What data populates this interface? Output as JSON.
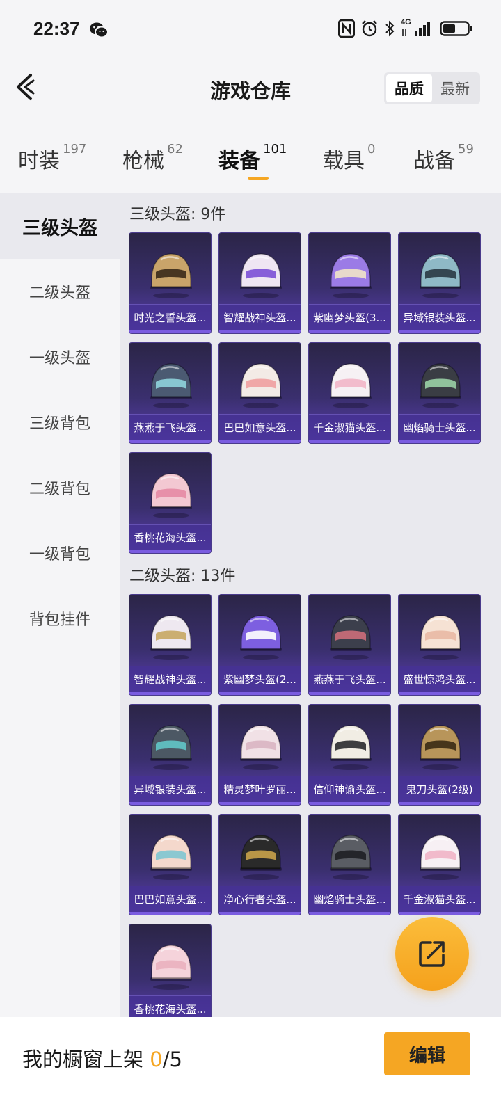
{
  "status_bar": {
    "time": "22:37",
    "network_label": "4G"
  },
  "header": {
    "title": "游戏仓库",
    "sort_options": [
      "品质",
      "最新"
    ],
    "sort_selected": "品质"
  },
  "tabs": [
    {
      "label": "时装",
      "count": "197"
    },
    {
      "label": "枪械",
      "count": "62"
    },
    {
      "label": "装备",
      "count": "101",
      "active": true
    },
    {
      "label": "载具",
      "count": "0"
    },
    {
      "label": "战备",
      "count": "59"
    }
  ],
  "sidebar": {
    "items": [
      {
        "label": "三级头盔",
        "active": true
      },
      {
        "label": "二级头盔"
      },
      {
        "label": "一级头盔"
      },
      {
        "label": "三级背包"
      },
      {
        "label": "二级背包"
      },
      {
        "label": "一级背包"
      },
      {
        "label": "背包挂件"
      }
    ]
  },
  "sections": [
    {
      "title": "三级头盔: 9件",
      "items": [
        {
          "name": "时光之誓头盔...",
          "color": "#c9a46a",
          "visor": "#3a2a1a"
        },
        {
          "name": "智耀战神头盔...",
          "color": "#efe6f3",
          "visor": "#7b4fd6"
        },
        {
          "name": "紫幽梦头盔(3...",
          "color": "#9b7be6",
          "visor": "#f1e4c8"
        },
        {
          "name": "异域银装头盔...",
          "color": "#8fb9c6",
          "visor": "#2a3a44"
        },
        {
          "name": "燕燕于飞头盔...",
          "color": "#4b5a72",
          "visor": "#8fd3dc"
        },
        {
          "name": "巴巴如意头盔...",
          "color": "#f3ebe6",
          "visor": "#f0a0a0"
        },
        {
          "name": "千金淑猫头盔...",
          "color": "#f6f1f4",
          "visor": "#f2b6c8"
        },
        {
          "name": "幽焰骑士头盔...",
          "color": "#3a3d44",
          "visor": "#9ad0a6"
        },
        {
          "name": "香桃花海头盔...",
          "color": "#f3c8d2",
          "visor": "#e58aa4"
        }
      ]
    },
    {
      "title": "二级头盔: 13件",
      "items": [
        {
          "name": "智耀战神头盔...",
          "color": "#eee8f0",
          "visor": "#c7a763"
        },
        {
          "name": "紫幽梦头盔(2...",
          "color": "#7d5fe0",
          "visor": "#ffffff"
        },
        {
          "name": "燕燕于飞头盔...",
          "color": "#3c3f4c",
          "visor": "#cc6e7a"
        },
        {
          "name": "盛世惊鸿头盔...",
          "color": "#f6e2d4",
          "visor": "#e9b9a4"
        },
        {
          "name": "异域银装头盔...",
          "color": "#4c5864",
          "visor": "#62c7c7"
        },
        {
          "name": "精灵梦叶罗丽...",
          "color": "#f1e1e6",
          "visor": "#d9b5c2"
        },
        {
          "name": "信仰神谕头盔...",
          "color": "#f1ede4",
          "visor": "#2a2a2e"
        },
        {
          "name": "鬼刀头盔(2级)",
          "color": "#b8955a",
          "visor": "#3a2a14"
        },
        {
          "name": "巴巴如意头盔...",
          "color": "#f4d8cc",
          "visor": "#7fc6d2"
        },
        {
          "name": "净心行者头盔...",
          "color": "#2a2a2a",
          "visor": "#c9a24a"
        },
        {
          "name": "幽焰骑士头盔...",
          "color": "#5a5d64",
          "visor": "#1e1f24"
        },
        {
          "name": "千金淑猫头盔...",
          "color": "#f7f0f4",
          "visor": "#f0b4c6"
        },
        {
          "name": "香桃花海头盔...",
          "color": "#f5d3db",
          "visor": "#eab0be"
        }
      ]
    }
  ],
  "bottom_bar": {
    "showcase_label": "我的橱窗上架",
    "showcase_current": "0",
    "showcase_total": "/5",
    "edit_label": "编辑"
  },
  "colors": {
    "accent": "#f5a623",
    "card_bg": "#3a2f6e"
  }
}
